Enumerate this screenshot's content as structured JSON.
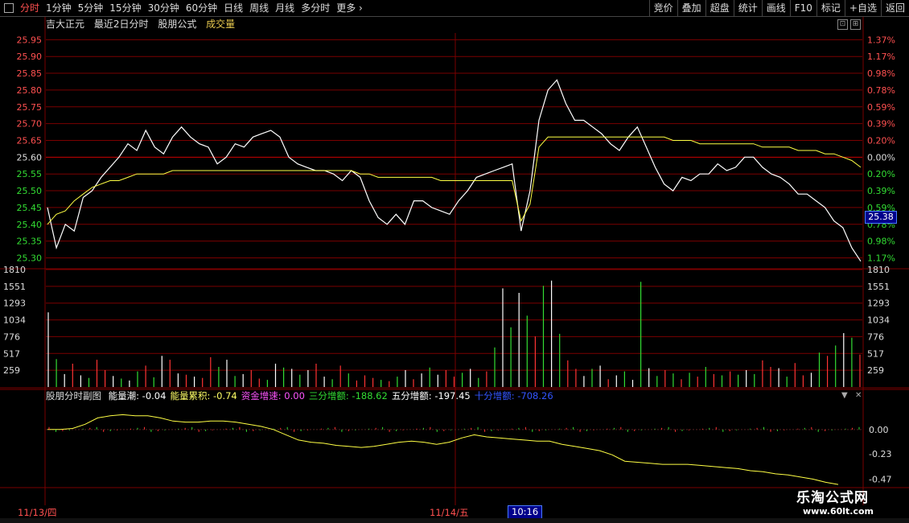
{
  "toolbar": {
    "left": [
      "分时",
      "1分钟",
      "5分钟",
      "15分钟",
      "30分钟",
      "60分钟",
      "日线",
      "周线",
      "月线",
      "多分时",
      "更多"
    ],
    "right": [
      "竞价",
      "叠加",
      "超盘",
      "统计",
      "画线",
      "F10",
      "标记",
      "+自选",
      "返回"
    ]
  },
  "title": {
    "stock": "吉大正元",
    "mode": "最近2日分时",
    "formula": "股朋公式",
    "volume_label": "成交量"
  },
  "price_box": "25.38",
  "sub_title": {
    "name": "股朋分时副图",
    "items": [
      {
        "label": "能量潮",
        "value": "-0.04",
        "color": "#ffffff"
      },
      {
        "label": "能量累积",
        "value": "-0.74",
        "color": "#ffff66"
      },
      {
        "label": "资金增速",
        "value": "0.00",
        "color": "#ff55ff"
      },
      {
        "label": "三分增额",
        "value": "-188.62",
        "color": "#33dd33"
      },
      {
        "label": "五分增额",
        "value": "-197.45",
        "color": "#ffffff"
      },
      {
        "label": "十分增额",
        "value": "-708.26",
        "color": "#3355ff"
      }
    ]
  },
  "dates": {
    "day1": "11/13/四",
    "day2": "11/14/五",
    "cursor_time": "10:16"
  },
  "watermark": {
    "line1": "乐淘公式网",
    "line2": "www.60lt.com"
  },
  "colors": {
    "up": "#ff3333",
    "down": "#33dd33",
    "price_line": "#ffffff",
    "avg_line": "#ffff44",
    "grid": "#7a0000",
    "axis_text_up": "#ff5050",
    "axis_text_down": "#33dd33"
  },
  "chart_data": [
    {
      "type": "line",
      "name": "price",
      "series": [
        {
          "name": "price",
          "role": "price",
          "values": [
            25.45,
            25.33,
            25.4,
            25.38,
            25.48,
            25.5,
            25.54,
            25.57,
            25.6,
            25.64,
            25.62,
            25.68,
            25.63,
            25.61,
            25.66,
            25.69,
            25.66,
            25.64,
            25.63,
            25.58,
            25.6,
            25.64,
            25.63,
            25.66,
            25.67,
            25.68,
            25.66,
            25.6,
            25.58,
            25.57,
            25.56,
            25.56,
            25.55,
            25.53,
            25.56,
            25.54,
            25.47,
            25.42,
            25.4,
            25.43,
            25.4,
            25.47,
            25.47,
            25.45,
            25.44,
            25.43,
            25.47,
            25.5,
            25.54,
            25.55,
            25.56,
            25.57,
            25.58,
            25.38,
            25.5,
            25.71,
            25.8,
            25.83,
            25.76,
            25.71,
            25.71,
            25.69,
            25.67,
            25.64,
            25.62,
            25.66,
            25.69,
            25.63,
            25.57,
            25.52,
            25.5,
            25.54,
            25.53,
            25.55,
            25.55,
            25.58,
            25.56,
            25.57,
            25.6,
            25.6,
            25.57,
            25.55,
            25.54,
            25.52,
            25.49,
            25.49,
            25.47,
            25.45,
            25.41,
            25.39,
            25.33,
            25.29
          ]
        },
        {
          "name": "average",
          "role": "avg",
          "values": [
            25.4,
            25.43,
            25.44,
            25.47,
            25.49,
            25.51,
            25.52,
            25.53,
            25.53,
            25.54,
            25.55,
            25.55,
            25.55,
            25.55,
            25.56,
            25.56,
            25.56,
            25.56,
            25.56,
            25.56,
            25.56,
            25.56,
            25.56,
            25.56,
            25.56,
            25.56,
            25.56,
            25.56,
            25.56,
            25.56,
            25.56,
            25.56,
            25.56,
            25.56,
            25.56,
            25.55,
            25.55,
            25.54,
            25.54,
            25.54,
            25.54,
            25.54,
            25.54,
            25.54,
            25.53,
            25.53,
            25.53,
            25.53,
            25.53,
            25.53,
            25.53,
            25.53,
            25.53,
            25.41,
            25.46,
            25.63,
            25.66,
            25.66,
            25.66,
            25.66,
            25.66,
            25.66,
            25.66,
            25.66,
            25.66,
            25.66,
            25.66,
            25.66,
            25.66,
            25.66,
            25.65,
            25.65,
            25.65,
            25.64,
            25.64,
            25.64,
            25.64,
            25.64,
            25.64,
            25.64,
            25.63,
            25.63,
            25.63,
            25.63,
            25.62,
            25.62,
            25.62,
            25.61,
            25.61,
            25.6,
            25.59,
            25.57
          ]
        }
      ],
      "ylim": [
        25.27,
        25.97
      ],
      "left_ticks": [
        "25.95",
        "25.90",
        "25.85",
        "25.80",
        "25.75",
        "25.70",
        "25.65",
        "25.60",
        "25.55",
        "25.50",
        "25.45",
        "25.40",
        "25.35",
        "25.30"
      ],
      "right_ticks": [
        "1.37%",
        "1.17%",
        "0.98%",
        "0.78%",
        "0.59%",
        "0.39%",
        "0.20%",
        "0.00%",
        "0.20%",
        "0.39%",
        "0.59%",
        "0.78%",
        "0.98%",
        "1.17%"
      ],
      "grid": true
    },
    {
      "type": "bar",
      "name": "volume",
      "ylim": [
        0,
        1810
      ],
      "left_ticks": [
        "1810",
        "1551",
        "1293",
        "1034",
        "776",
        "517",
        "259"
      ],
      "values": [
        1150,
        430,
        200,
        360,
        180,
        140,
        420,
        260,
        170,
        130,
        100,
        240,
        330,
        150,
        480,
        420,
        210,
        190,
        160,
        140,
        460,
        310,
        420,
        170,
        200,
        260,
        130,
        110,
        360,
        300,
        280,
        190,
        260,
        360,
        160,
        120,
        330,
        210,
        100,
        180,
        140,
        110,
        90,
        160,
        260,
        120,
        210,
        300,
        190,
        260,
        160,
        220,
        280,
        140,
        240,
        610,
        1520,
        920,
        1450,
        1100,
        780,
        1560,
        1640,
        820,
        410,
        280,
        170,
        280,
        330,
        120,
        180,
        240,
        110,
        1620,
        290,
        170,
        260,
        210,
        120,
        220,
        160,
        310,
        200,
        180,
        240,
        190,
        260,
        200,
        410,
        310,
        290,
        160,
        370,
        180,
        220,
        530,
        480,
        640,
        830,
        760,
        500
      ]
    },
    {
      "type": "line",
      "name": "sub-indicator",
      "ylim": [
        -0.55,
        0.25
      ],
      "left_ticks": [
        "0.00",
        "-0.23",
        "-0.47"
      ],
      "series": [
        {
          "name": "能量累积",
          "values": [
            0.0,
            0.0,
            0.01,
            0.05,
            0.11,
            0.13,
            0.14,
            0.13,
            0.13,
            0.11,
            0.08,
            0.07,
            0.07,
            0.08,
            0.08,
            0.07,
            0.05,
            0.03,
            0.0,
            -0.05,
            -0.1,
            -0.12,
            -0.13,
            -0.15,
            -0.16,
            -0.17,
            -0.16,
            -0.14,
            -0.12,
            -0.11,
            -0.12,
            -0.14,
            -0.12,
            -0.08,
            -0.05,
            -0.07,
            -0.08,
            -0.09,
            -0.1,
            -0.11,
            -0.11,
            -0.14,
            -0.16,
            -0.18,
            -0.2,
            -0.24,
            -0.3,
            -0.31,
            -0.32,
            -0.33,
            -0.33,
            -0.33,
            -0.34,
            -0.35,
            -0.36,
            -0.37,
            -0.39,
            -0.4,
            -0.42,
            -0.43,
            -0.45,
            -0.47,
            -0.5,
            -0.52
          ]
        }
      ]
    }
  ]
}
